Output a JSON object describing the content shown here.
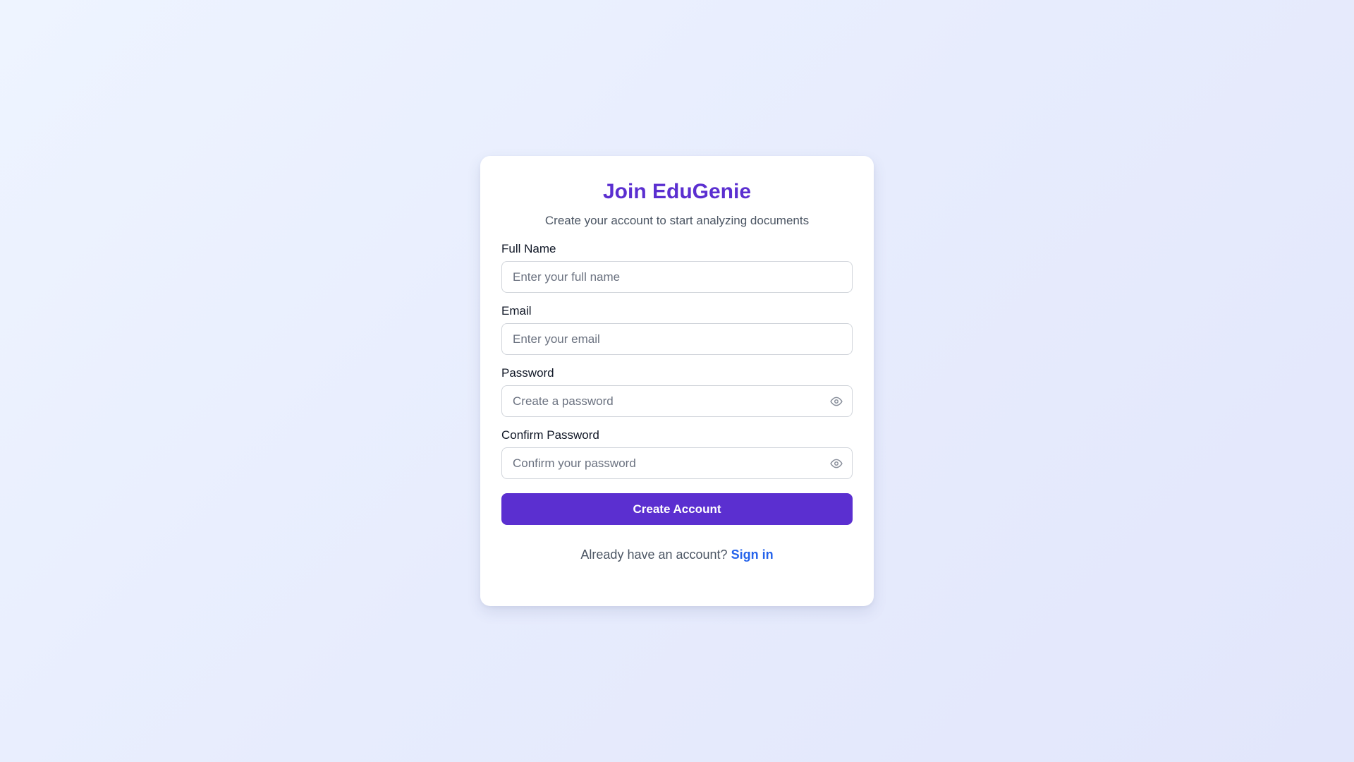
{
  "signup": {
    "title": "Join EduGenie",
    "subtitle": "Create your account to start analyzing documents",
    "fields": [
      {
        "label": "Full Name",
        "placeholder": "Enter your full name",
        "value": ""
      },
      {
        "label": "Email",
        "placeholder": "Enter your email",
        "value": ""
      },
      {
        "label": "Password",
        "placeholder": "Create a password",
        "value": "",
        "icon": "eye-icon"
      },
      {
        "label": "Confirm Password",
        "placeholder": "Confirm your password",
        "value": "",
        "icon": "eye-icon"
      }
    ],
    "submit_label": "Create Account",
    "footer_text": "Already have an account?",
    "footer_link": "Sign in"
  },
  "colors": {
    "brand": "#5b2fd0",
    "link": "#2563eb",
    "text": "#111827",
    "muted": "#4b5563",
    "border": "#d1d5db"
  }
}
